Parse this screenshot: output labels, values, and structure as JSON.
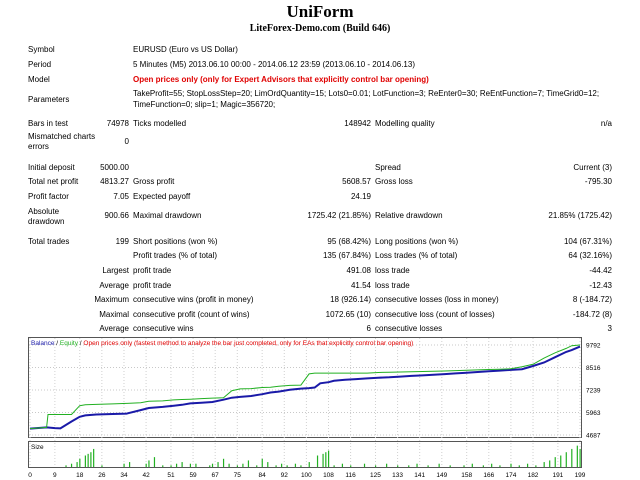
{
  "title": "UniForm",
  "subtitle": "LiteForex-Demo.com (Build 646)",
  "header": {
    "symbol_label": "Symbol",
    "symbol_value": "EURUSD (Euro vs US Dollar)",
    "period_label": "Period",
    "period_value": "5 Minutes (M5) 2013.06.10 00:00 - 2014.06.12 23:59 (2013.06.10 - 2014.06.13)",
    "model_label": "Model",
    "model_value": "Open prices only (only for Expert Advisors that explicitly control bar opening)",
    "parameters_label": "Parameters",
    "parameters_line1": "TakeProfit=55; StopLossStep=20; LimOrdQuantity=15; Lots0=0.01; LotFunction=3; ReEnter0=30; ReEntFunction=7; TimeGrid0=12;",
    "parameters_line2": "TimeFunction=0; slip=1; Magic=356720;"
  },
  "stats": {
    "bars_label": "Bars in test",
    "bars_value": "74978",
    "ticks_label": "Ticks modelled",
    "ticks_value": "148942",
    "quality_label": "Modelling quality",
    "quality_value": "n/a",
    "mismatch_label_1": "Mismatched charts",
    "mismatch_label_2": "errors",
    "mismatch_value": "0",
    "deposit_label": "Initial deposit",
    "deposit_value": "5000.00",
    "spread_label": "Spread",
    "spread_value": "Current (3)",
    "net_label": "Total net profit",
    "net_value": "4813.27",
    "gross_profit_label": "Gross profit",
    "gross_profit_value": "5608.57",
    "gross_loss_label": "Gross loss",
    "gross_loss_value": "-795.30",
    "pf_label": "Profit factor",
    "pf_value": "7.05",
    "payoff_label": "Expected payoff",
    "payoff_value": "24.19",
    "abs_dd_label_1": "Absolute",
    "abs_dd_label_2": "drawdown",
    "abs_dd_value": "900.66",
    "max_dd_label": "Maximal drawdown",
    "max_dd_value": "1725.42 (21.85%)",
    "rel_dd_label": "Relative drawdown",
    "rel_dd_value": "21.85% (1725.42)",
    "trades_label": "Total trades",
    "trades_value": "199",
    "short_label": "Short positions (won %)",
    "short_value": "95 (68.42%)",
    "long_label": "Long positions (won %)",
    "long_value": "104 (67.31%)",
    "profit_trades_label": "Profit trades (% of total)",
    "profit_trades_value": "135 (67.84%)",
    "loss_trades_label": "Loss trades (% of total)",
    "loss_trades_value": "64 (32.16%)",
    "largest": "Largest",
    "largest_profit_label": "profit trade",
    "largest_profit_value": "491.08",
    "largest_loss_label": "loss trade",
    "largest_loss_value": "-44.42",
    "average": "Average",
    "avg_profit_label": "profit trade",
    "avg_profit_value": "41.54",
    "avg_loss_label": "loss trade",
    "avg_loss_value": "-12.43",
    "maximum": "Maximum",
    "max_cons_wins_label": "consecutive wins (profit in money)",
    "max_cons_wins_value": "18 (926.14)",
    "max_cons_losses_label": "consecutive losses (loss in money)",
    "max_cons_losses_value": "8 (-184.72)",
    "maximal": "Maximal",
    "max_cons_profit_label": "consecutive profit (count of wins)",
    "max_cons_profit_value": "1072.65 (10)",
    "max_cons_loss_label": "consecutive loss (count of losses)",
    "max_cons_loss_value": "-184.72 (8)",
    "average2": "Average",
    "avg_cons_wins_label": "consecutive wins",
    "avg_cons_wins_value": "6",
    "avg_cons_losses_label": "consecutive losses",
    "avg_cons_losses_value": "3"
  },
  "chart_legend": {
    "balance": "Balance",
    "sep1": " / ",
    "equity": "Equity",
    "sep2": " / ",
    "mode": "Open prices only (fastest method to analyze the bar just completed, only for EAs that explicitly control bar opening)"
  },
  "size_label": "Size",
  "colors": {
    "balance": "#1a1aa8",
    "equity": "#22b022",
    "mode": "#e00000",
    "size_bars": "#22b022"
  },
  "chart_data": {
    "type": "line",
    "y_ticks": [
      "9792",
      "8516",
      "7239",
      "5963",
      "4687"
    ],
    "ylim": [
      4687,
      9792
    ],
    "x_ticks": [
      "0",
      "9",
      "18",
      "26",
      "34",
      "42",
      "51",
      "59",
      "67",
      "75",
      "84",
      "92",
      "100",
      "108",
      "116",
      "125",
      "133",
      "141",
      "149",
      "158",
      "166",
      "174",
      "182",
      "191",
      "199"
    ],
    "xlim": [
      0,
      199
    ],
    "series": [
      {
        "name": "Balance",
        "x": [
          0,
          6,
          9,
          11,
          15,
          18,
          20,
          24,
          30,
          35,
          40,
          43,
          48,
          52,
          55,
          58,
          62,
          66,
          70,
          73,
          76,
          80,
          84,
          87,
          90,
          94,
          98,
          101,
          103,
          105,
          108,
          110,
          114,
          118,
          122,
          126,
          130,
          134,
          138,
          142,
          146,
          150,
          154,
          158,
          162,
          166,
          170,
          174,
          178,
          182,
          186,
          190,
          194,
          196,
          199
        ],
        "y": [
          5050,
          5120,
          5080,
          5060,
          5450,
          5720,
          5800,
          5850,
          5880,
          5900,
          6100,
          6220,
          6280,
          6350,
          6400,
          6480,
          6520,
          6560,
          6690,
          6800,
          6850,
          6900,
          7000,
          7100,
          7150,
          7250,
          7320,
          7350,
          7380,
          7620,
          7680,
          7760,
          7820,
          7860,
          7900,
          7940,
          7960,
          8000,
          8040,
          8070,
          8100,
          8140,
          8180,
          8220,
          8260,
          8300,
          8340,
          8380,
          8420,
          8600,
          8800,
          9100,
          9400,
          9500,
          9700
        ]
      },
      {
        "name": "Equity",
        "x": [
          0,
          6,
          6.5,
          9,
          11,
          15,
          18,
          20,
          24,
          30,
          35,
          40,
          43,
          48,
          52,
          55,
          58,
          62,
          66,
          70,
          73,
          76,
          80,
          84,
          87,
          90,
          94,
          98,
          101,
          103,
          105,
          108,
          110,
          114,
          118,
          122,
          126,
          130,
          134,
          138,
          142,
          146,
          150,
          154,
          158,
          162,
          166,
          170,
          174,
          178,
          182,
          186,
          190,
          194,
          196,
          199
        ],
        "y": [
          5050,
          5120,
          5850,
          5850,
          5850,
          5850,
          6350,
          6400,
          6420,
          6450,
          6480,
          6520,
          6600,
          6620,
          6680,
          6700,
          6720,
          6750,
          6780,
          6800,
          7200,
          7300,
          7320,
          7380,
          7400,
          7450,
          7500,
          7520,
          8150,
          8200,
          8200,
          8200,
          8200,
          8200,
          8200,
          8200,
          8230,
          8250,
          8260,
          8280,
          8290,
          8300,
          8320,
          8340,
          8360,
          8380,
          8400,
          8420,
          8440,
          8560,
          8700,
          9050,
          9350,
          9600,
          9750,
          9792
        ]
      }
    ],
    "size_bars": {
      "x": [
        13,
        15,
        17,
        18,
        20,
        21,
        22,
        23,
        26,
        34,
        36,
        42,
        43,
        45,
        48,
        51,
        53,
        55,
        58,
        60,
        65,
        66,
        68,
        70,
        72,
        75,
        77,
        79,
        82,
        84,
        86,
        89,
        91,
        93,
        96,
        98,
        101,
        104,
        106,
        107,
        108,
        110,
        113,
        116,
        121,
        125,
        129,
        133,
        137,
        140,
        144,
        148,
        152,
        157,
        160,
        164,
        167,
        170,
        174,
        177,
        180,
        183,
        186,
        188,
        190,
        192,
        194,
        196,
        198,
        199
      ],
      "y": [
        1,
        2,
        3,
        5,
        7,
        8,
        9,
        11,
        1,
        2,
        3,
        2,
        4,
        6,
        1,
        1,
        2,
        3,
        2,
        2,
        1,
        2,
        3,
        5,
        2,
        1,
        2,
        4,
        1,
        5,
        3,
        1,
        2,
        1,
        2,
        1,
        3,
        7,
        8,
        9,
        10,
        1,
        2,
        1,
        2,
        1,
        2,
        1,
        1,
        2,
        1,
        2,
        1,
        1,
        2,
        1,
        2,
        1,
        2,
        1,
        2,
        1,
        3,
        4,
        6,
        7,
        9,
        11,
        13,
        11
      ]
    }
  }
}
